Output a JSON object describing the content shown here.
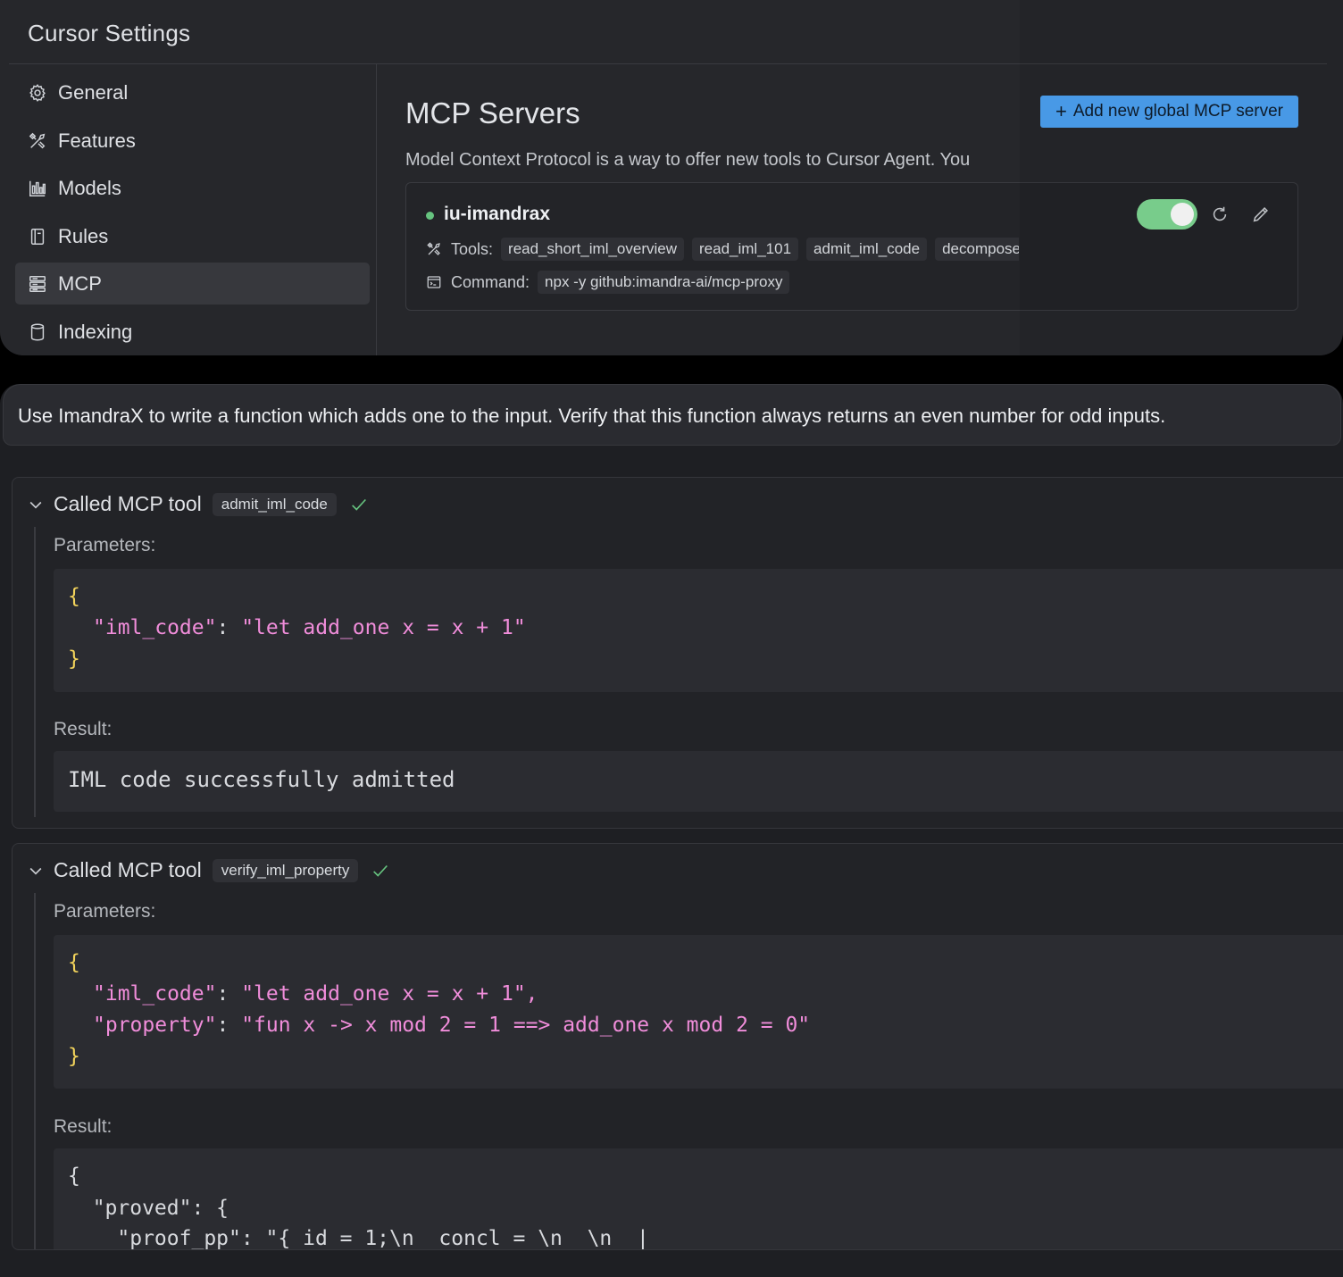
{
  "settings": {
    "title": "Cursor Settings",
    "nav": [
      {
        "label": "General",
        "icon": "gear-icon"
      },
      {
        "label": "Features",
        "icon": "tools-icon"
      },
      {
        "label": "Models",
        "icon": "bar-chart-icon"
      },
      {
        "label": "Rules",
        "icon": "book-icon"
      },
      {
        "label": "MCP",
        "icon": "server-icon",
        "active": true
      },
      {
        "label": "Indexing",
        "icon": "database-icon"
      }
    ],
    "mcp": {
      "heading": "MCP Servers",
      "description": "Model Context Protocol is a way to offer new tools to Cursor Agent. You",
      "add_button": "Add new global MCP server",
      "server": {
        "name": "iu-imandrax",
        "status": "enabled",
        "tools_label": "Tools:",
        "tools": [
          "read_short_iml_overview",
          "read_iml_101",
          "admit_iml_code",
          "decompose"
        ],
        "command_label": "Command:",
        "command": "npx -y github:imandra-ai/mcp-proxy"
      }
    }
  },
  "chat": {
    "prompt": "Use ImandraX to write a function which adds one to the input. Verify that this function always returns an even number for odd inputs.",
    "calls": [
      {
        "title": "Called MCP tool",
        "tool": "admit_iml_code",
        "params_label": "Parameters:",
        "param_key_1": "\"iml_code\"",
        "param_val_1": "\"let add_one x = x + 1\"",
        "result_label": "Result:",
        "result": "IML code successfully admitted"
      },
      {
        "title": "Called MCP tool",
        "tool": "verify_iml_property",
        "params_label": "Parameters:",
        "param_key_1": "\"iml_code\"",
        "param_val_1": "\"let add_one x = x + 1\",",
        "param_key_2": "\"property\"",
        "param_val_2": "\"fun x -> x mod 2 = 1 ==> add_one x mod 2 = 0\"",
        "result_label": "Result:",
        "result_line_1": "{",
        "result_line_2": "  \"proved\": {",
        "result_line_3": "    \"proof_pp\": \"{ id = 1;\\n  concl = \\n  \\n  |"
      }
    ]
  },
  "colors": {
    "accent": "#4da3f5",
    "toggle_on": "#80d994",
    "status_dot": "#66c37f",
    "check": "#66c37f",
    "code_brace": "#f2d35b",
    "code_string": "#f08dda"
  }
}
